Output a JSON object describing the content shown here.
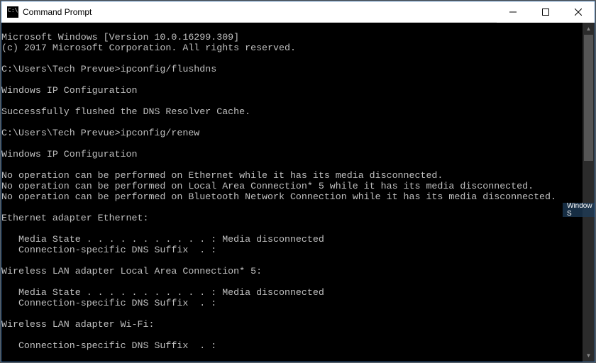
{
  "window": {
    "title": "Command Prompt"
  },
  "toast": {
    "text": "Window S"
  },
  "terminal": {
    "lines": [
      "Microsoft Windows [Version 10.0.16299.309]",
      "(c) 2017 Microsoft Corporation. All rights reserved.",
      "",
      "C:\\Users\\Tech Prevue>ipconfig/flushdns",
      "",
      "Windows IP Configuration",
      "",
      "Successfully flushed the DNS Resolver Cache.",
      "",
      "C:\\Users\\Tech Prevue>ipconfig/renew",
      "",
      "Windows IP Configuration",
      "",
      "No operation can be performed on Ethernet while it has its media disconnected.",
      "No operation can be performed on Local Area Connection* 5 while it has its media disconnected.",
      "No operation can be performed on Bluetooth Network Connection while it has its media disconnected.",
      "",
      "Ethernet adapter Ethernet:",
      "",
      "   Media State . . . . . . . . . . . : Media disconnected",
      "   Connection-specific DNS Suffix  . :",
      "",
      "Wireless LAN adapter Local Area Connection* 5:",
      "",
      "   Media State . . . . . . . . . . . : Media disconnected",
      "   Connection-specific DNS Suffix  . :",
      "",
      "Wireless LAN adapter Wi-Fi:",
      "",
      "   Connection-specific DNS Suffix  . :"
    ]
  }
}
